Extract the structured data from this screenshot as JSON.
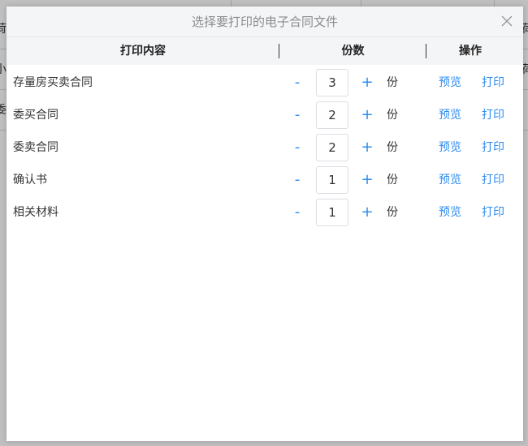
{
  "background": {
    "fragments": [
      "荷",
      "小",
      "委",
      "荷",
      "荷"
    ]
  },
  "modal": {
    "title": "选择要打印的电子合同文件",
    "close_icon": "close-icon"
  },
  "table": {
    "headers": {
      "content": "打印内容",
      "copies": "份数",
      "actions": "操作"
    },
    "rows": [
      {
        "name": "存量房买卖合同",
        "copies": "3",
        "unit": "份",
        "preview": "预览",
        "print": "打印",
        "minus": "-",
        "plus": "+"
      },
      {
        "name": "委买合同",
        "copies": "2",
        "unit": "份",
        "preview": "预览",
        "print": "打印",
        "minus": "-",
        "plus": "+"
      },
      {
        "name": "委卖合同",
        "copies": "2",
        "unit": "份",
        "preview": "预览",
        "print": "打印",
        "minus": "-",
        "plus": "+"
      },
      {
        "name": "确认书",
        "copies": "1",
        "unit": "份",
        "preview": "预览",
        "print": "打印",
        "minus": "-",
        "plus": "+"
      },
      {
        "name": "相关材料",
        "copies": "1",
        "unit": "份",
        "preview": "预览",
        "print": "打印",
        "minus": "-",
        "plus": "+"
      }
    ]
  },
  "colors": {
    "accent": "#2d8cf0",
    "header_bg": "#f4f5f7",
    "title_text": "#8c8c8c"
  }
}
